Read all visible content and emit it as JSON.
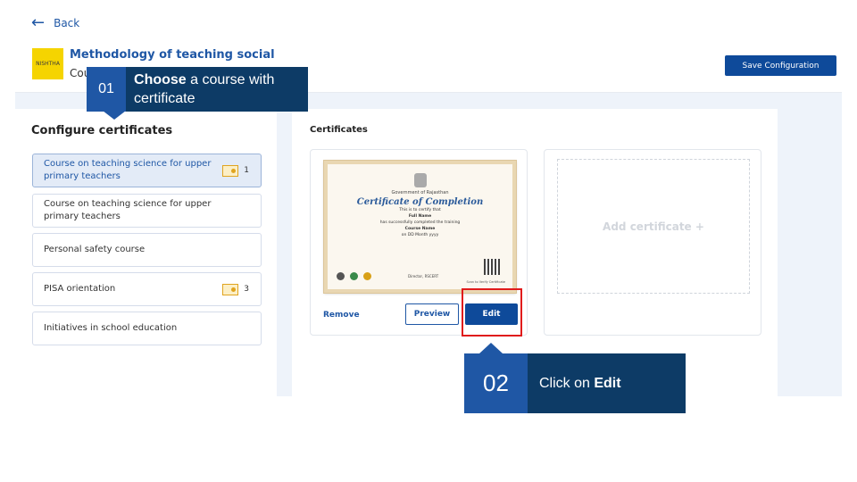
{
  "nav": {
    "back_label": "Back"
  },
  "header": {
    "logo_text": "NISHTHA",
    "course_title": "Methodology of teaching social",
    "course_sub": "Cou",
    "save_label": "Save Configuration"
  },
  "configure": {
    "title": "Configure certificates",
    "courses": [
      {
        "label": "Course on teaching science for upper primary teachers",
        "cert_count": "1",
        "selected": true
      },
      {
        "label": "Course on teaching science for upper primary teachers",
        "cert_count": "",
        "selected": false
      },
      {
        "label": "Personal safety course",
        "cert_count": "",
        "selected": false
      },
      {
        "label": "PISA orientation",
        "cert_count": "3",
        "selected": false
      },
      {
        "label": "Initiatives in school education",
        "cert_count": "",
        "selected": false
      }
    ]
  },
  "certificates": {
    "title": "Certificates",
    "template": {
      "issuer": "Government of Rajasthan",
      "heading": "Certificate of Completion",
      "certify_line": "This is to certify that",
      "name": "Full Name",
      "completed_line": "has successfully completed the training",
      "course": "Course Name",
      "date": "on DD Month yyyy",
      "signatory": "Director, RSCERT",
      "verify": "Scan to Verify Certificate"
    },
    "remove_label": "Remove",
    "preview_label": "Preview",
    "edit_label": "Edit",
    "add_label": "Add certificate +"
  },
  "callouts": {
    "step1": {
      "num": "01",
      "bold": "Choose",
      "text": " a course with certificate"
    },
    "step2": {
      "num": "02",
      "text": "Click on ",
      "bold": "Edit"
    }
  },
  "colors": {
    "primary": "#0e4a9a",
    "accent": "#1f57a5",
    "callout_dark": "#0d3b66",
    "highlight": "#e01b1b"
  }
}
